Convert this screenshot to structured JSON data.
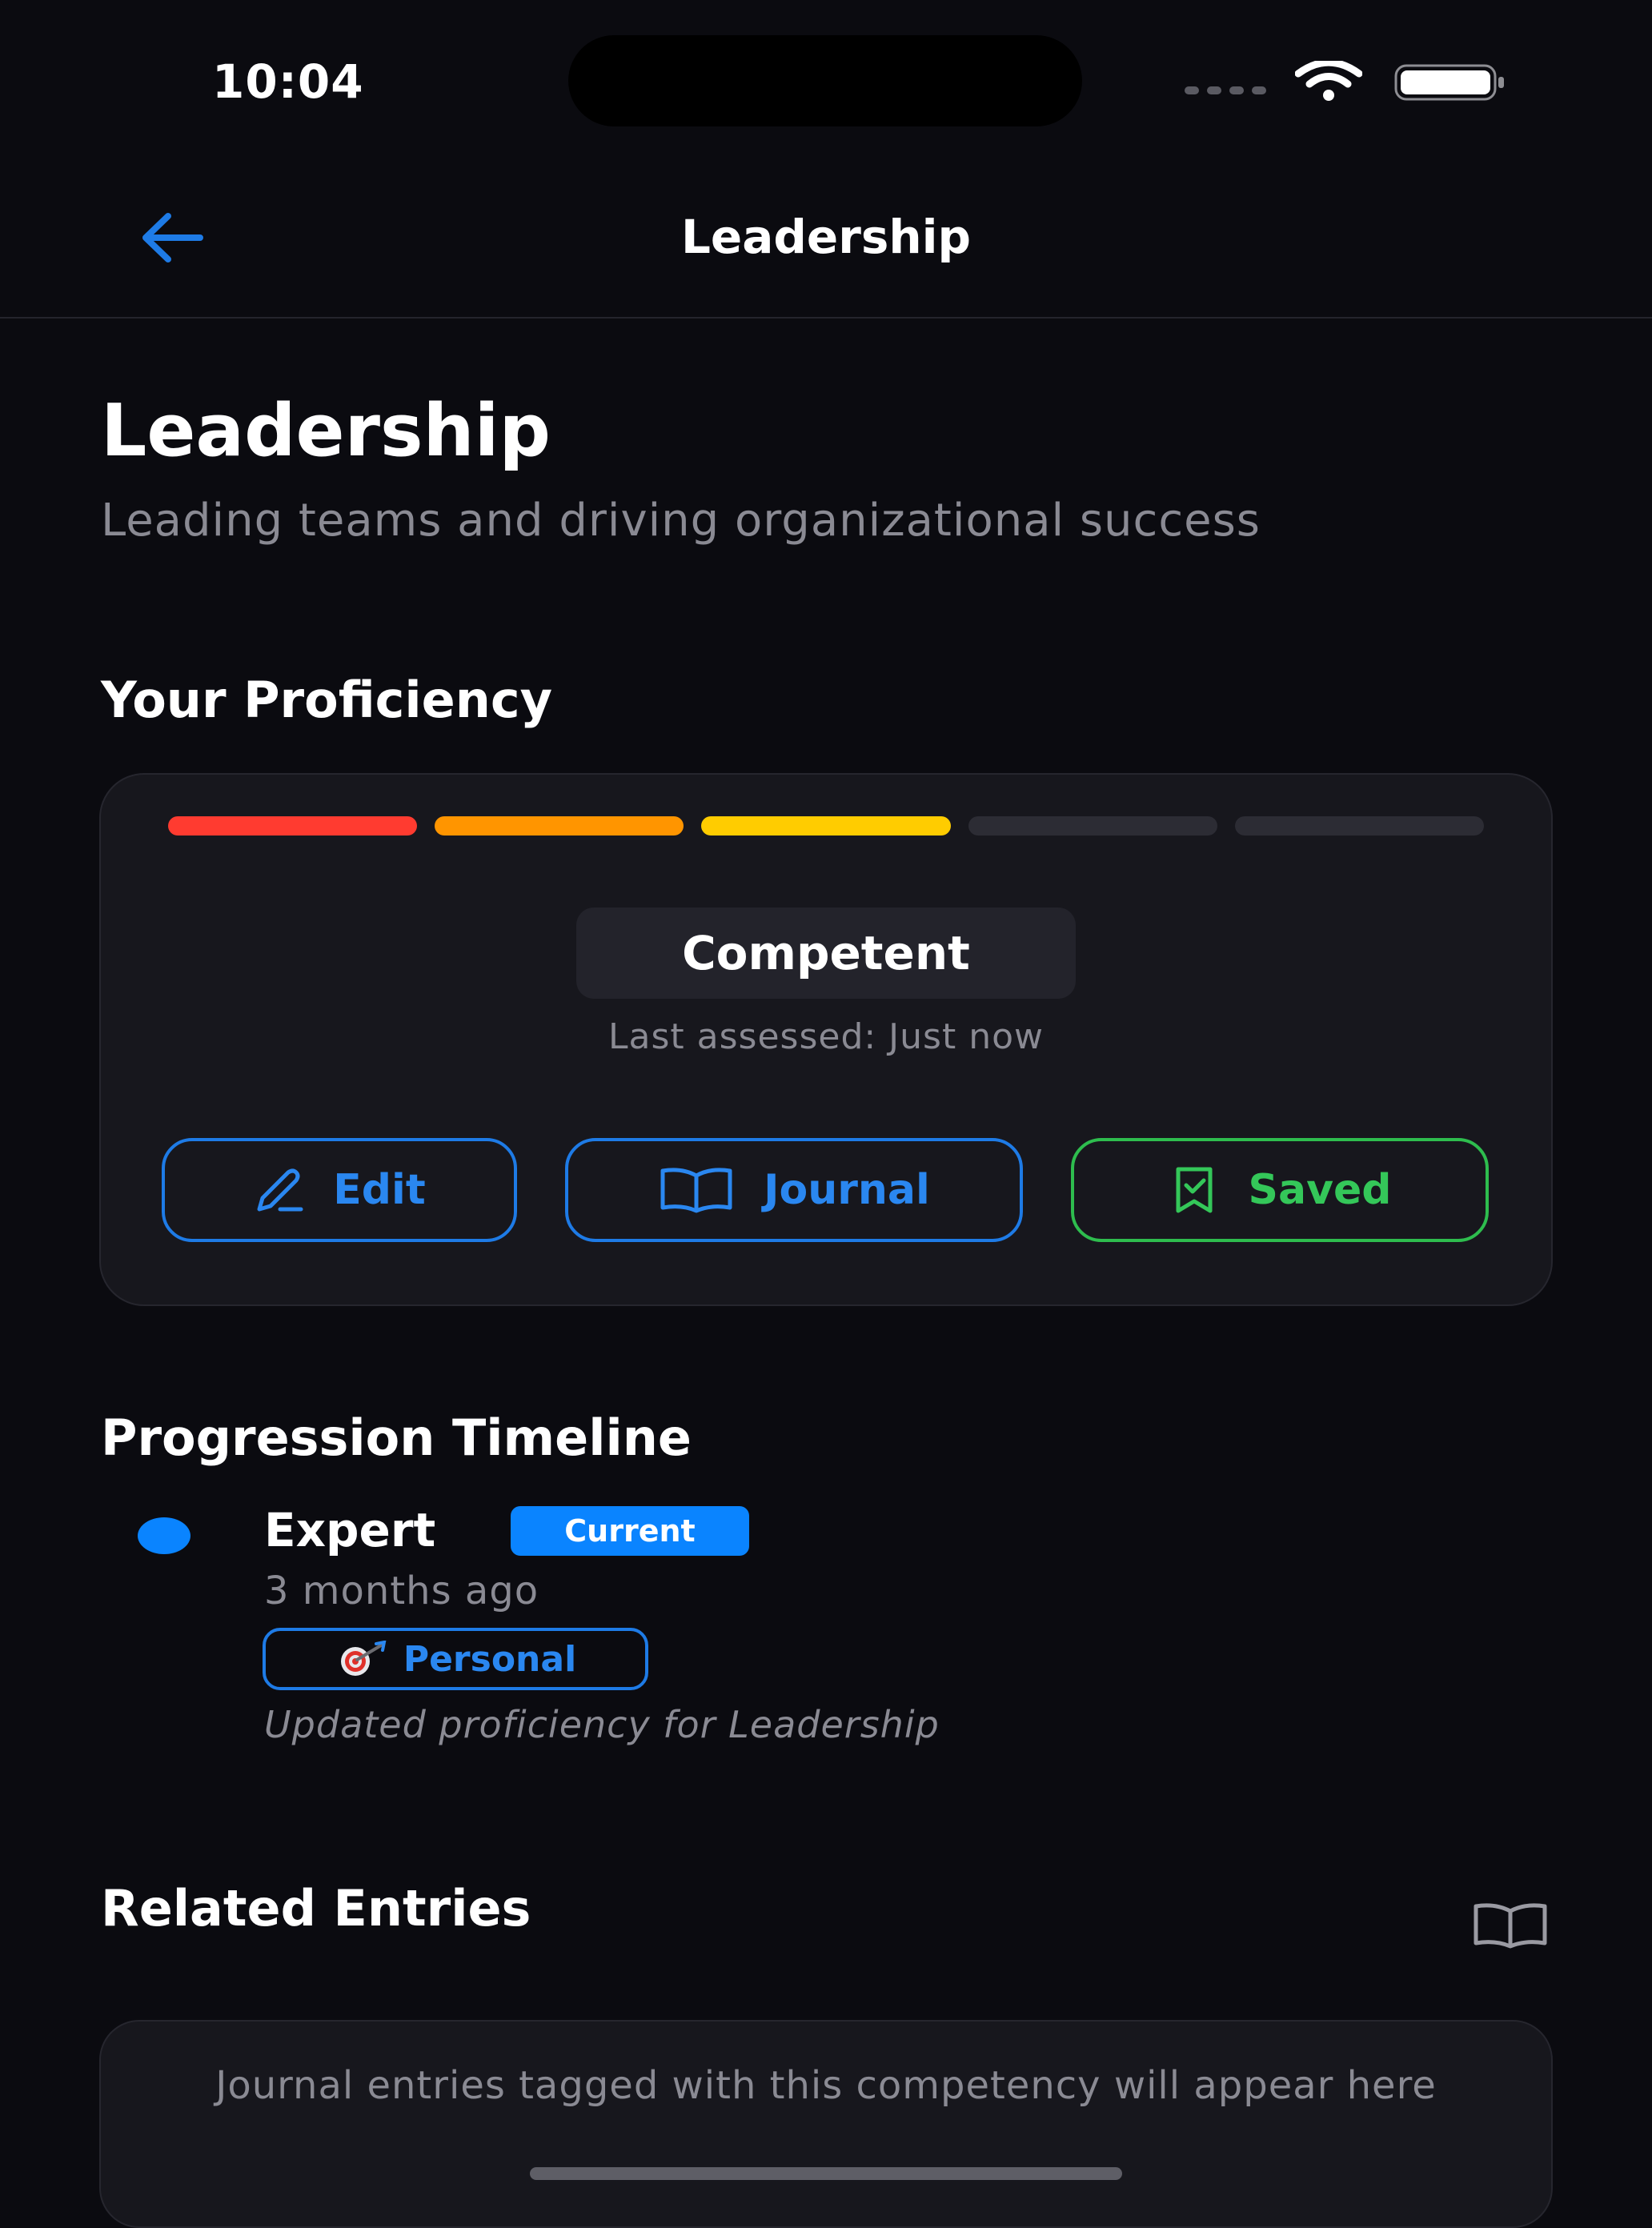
{
  "status_bar": {
    "time": "10:04"
  },
  "header": {
    "title": "Leadership",
    "back_icon": "arrow-left-icon"
  },
  "competency": {
    "title": "Leadership",
    "description": "Leading teams and driving organizational success"
  },
  "proficiency": {
    "heading": "Your Proficiency",
    "level_count": 5,
    "filled_levels": 3,
    "segment_colors": [
      "#ff3b30",
      "#ff9500",
      "#ffcc00",
      "#2c2c34",
      "#2c2c34"
    ],
    "level_label": "Competent",
    "last_assessed": "Last assessed: Just now",
    "buttons": {
      "edit": "Edit",
      "journal": "Journal",
      "saved": "Saved"
    }
  },
  "timeline": {
    "heading": "Progression Timeline",
    "entries": [
      {
        "level": "Expert",
        "badge": "Current",
        "time": "3 months ago",
        "tag": "Personal",
        "tag_icon": "target-dart-icon",
        "note": "Updated proficiency for Leadership"
      }
    ]
  },
  "related": {
    "heading": "Related Entries",
    "icon": "book-open-icon",
    "empty_text": "Journal entries tagged with this competency will appear here"
  },
  "colors": {
    "accent_blue": "#0a84ff",
    "saved_green": "#34c759",
    "background": "#0b0b10",
    "card": "#17171d"
  }
}
